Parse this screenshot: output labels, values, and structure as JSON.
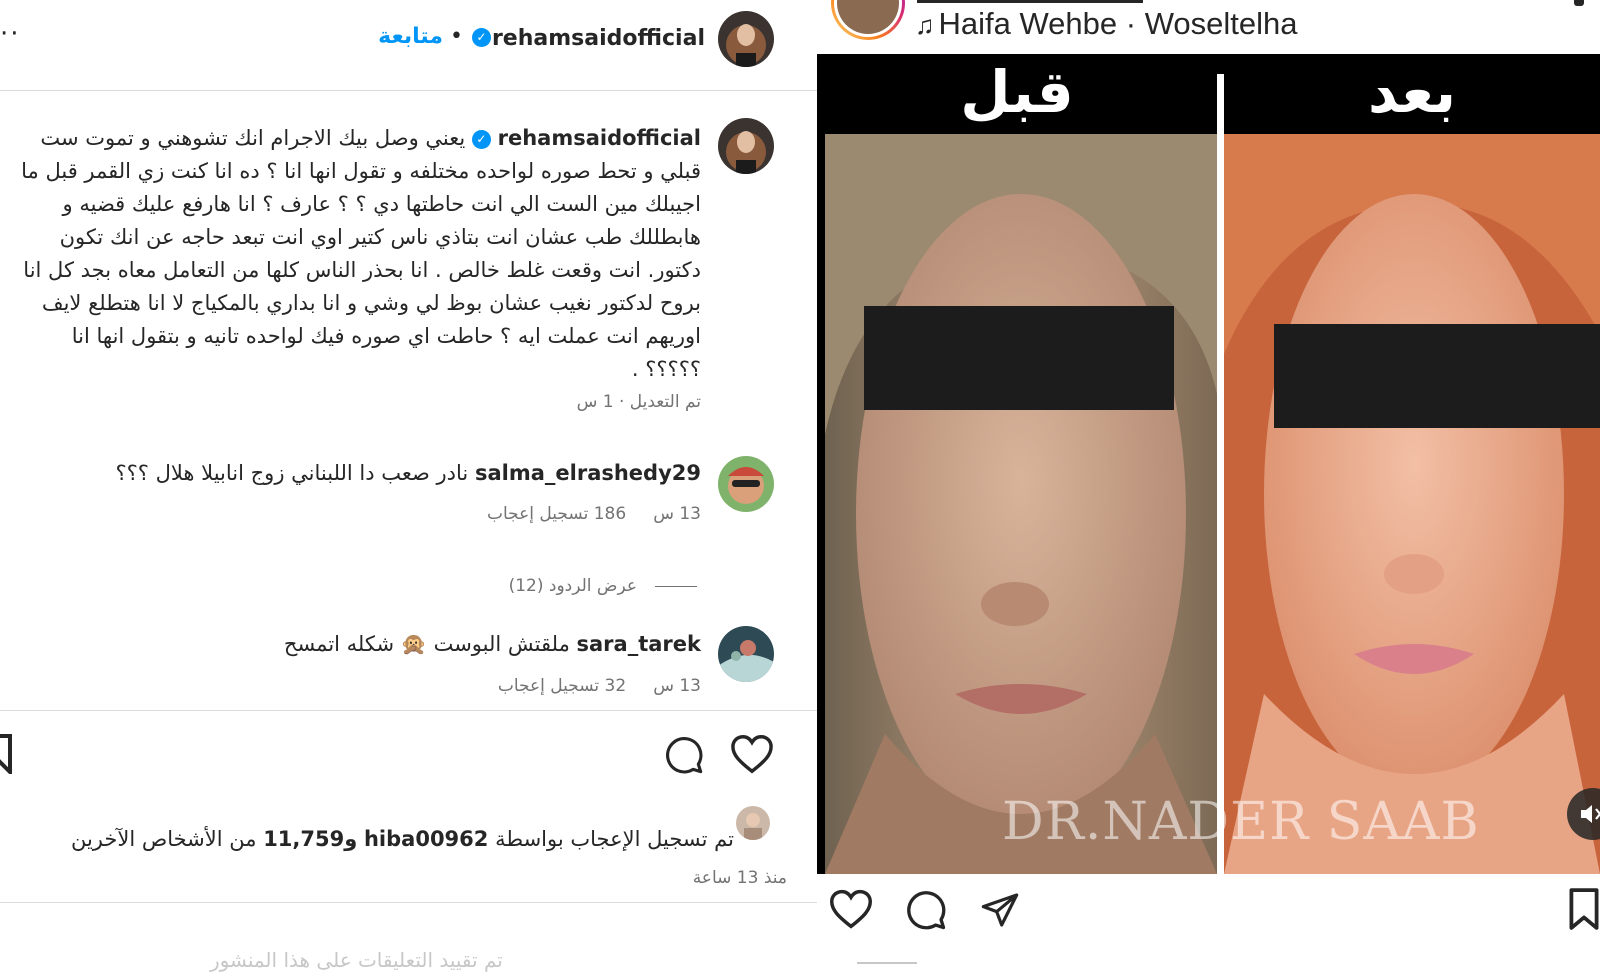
{
  "post_header": {
    "username": "rehamsaidofficial",
    "follow_label": "متابعة",
    "separator": "•",
    "more": "··"
  },
  "caption": {
    "username": "rehamsaidofficial",
    "text": "يعني وصل بيك الاجرام انك تشوهني و تموت ست قبلي و تحط صوره لواحده مختلفه و تقول انها انا ؟ ده انا كنت زي القمر قبل ما اجيبلك مين الست الي انت حاطتها دي ؟ ؟ عارف ؟ انا هارفع عليك قضيه و هابطللك طب عشان انت بتاذي ناس كتير اوي انت تبعد حاجه عن انك تكون دكتور. انت وقعت غلط خالص . انا بحذر الناس كلها من التعامل معاه بجد كل انا بروح لدكتور نغيب عشان بوظ لي وشي و انا بداري بالمكياج لا انا هتطلع لايف اوريهم انت عملت ايه ؟ حاطت اي صوره فيك لواحده تانيه و بتقول انها انا ؟؟؟؟؟ .",
    "meta": "تم التعديل · 1 س"
  },
  "comments": [
    {
      "username": "salma_elrashedy29",
      "text": "نادر صعب دا اللبناني زوج انابيلا هلال ؟؟؟",
      "time": "13 س",
      "likes": "186 تسجيل إعجاب"
    },
    {
      "username": "sara_tarek",
      "text": "ملقتش البوست 🙊 شكله اتمسح",
      "time": "13 س",
      "likes": "32 تسجيل إعجاب"
    }
  ],
  "view_replies": "عرض الردود (12)",
  "likes_summary": {
    "prefix": "تم تسجيل الإعجاب بواسطة",
    "user": "hiba00962",
    "count": "و11,759",
    "suffix": "من الأشخاص الآخرين"
  },
  "time_ago": "منذ 13 ساعة",
  "restricted_text": "تم تقييد التعليقات على هذا المنشور",
  "reel": {
    "audio": "Haifa Wehbe · Woseltelha",
    "label_before": "قبل",
    "label_after": "بعد",
    "watermark": "DR.NADER SAAB"
  },
  "icons": [
    "heart-icon",
    "comment-icon",
    "share-icon",
    "bookmark-icon",
    "music-note-icon",
    "mute-icon",
    "verified-icon"
  ],
  "colors": {
    "link_blue": "#0095f6",
    "text": "#262626",
    "muted": "#737373",
    "divider": "#dbdbdb"
  }
}
